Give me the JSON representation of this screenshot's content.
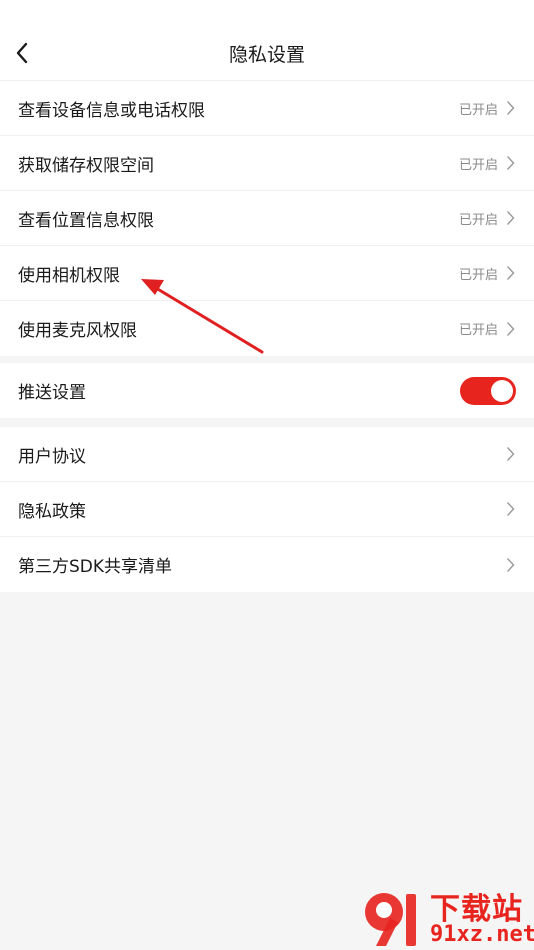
{
  "header": {
    "title": "隐私设置",
    "back_icon": "chevron-left-icon"
  },
  "permissions": [
    {
      "label": "查看设备信息或电话权限",
      "status": "已开启"
    },
    {
      "label": "获取储存权限空间",
      "status": "已开启"
    },
    {
      "label": "查看位置信息权限",
      "status": "已开启"
    },
    {
      "label": "使用相机权限",
      "status": "已开启"
    },
    {
      "label": "使用麦克风权限",
      "status": "已开启"
    }
  ],
  "push": {
    "label": "推送设置",
    "enabled": true
  },
  "links": [
    {
      "label": "用户协议"
    },
    {
      "label": "隐私政策"
    },
    {
      "label": "第三方SDK共享清单"
    }
  ],
  "watermark": {
    "title": "下载站",
    "domain": "91xz.net"
  },
  "colors": {
    "accent": "#e8241f",
    "background": "#f5f5f5",
    "status_text": "#8a8a8a"
  }
}
